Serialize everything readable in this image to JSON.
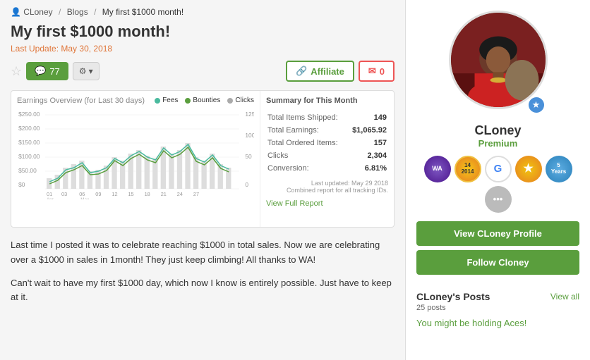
{
  "breadcrumb": {
    "user": "CLoney",
    "section": "Blogs",
    "current": "My first $1000 month!"
  },
  "post": {
    "title": "My first $1000 month!",
    "last_update_label": "Last Update:",
    "date": "May 30, 2018",
    "comment_count": "77",
    "paragraph1": "Last time I posted it was to celebrate reaching $1000 in total sales. Now we are celebrating over a $1000 in sales in 1month! They just keep climbing! All thanks to WA!",
    "paragraph2": "Can't wait to have my first $1000 day, which now I know is entirely possible. Just have to keep at it."
  },
  "toolbar": {
    "affiliate_label": "Affiliate",
    "mail_count": "0",
    "settings_icon": "⚙",
    "dropdown_icon": "▾",
    "star_icon": "☆",
    "comment_icon": "💬",
    "link_icon": "🔗",
    "mail_icon": "✉"
  },
  "chart": {
    "title": "Earnings Overview",
    "subtitle": "(for Last 30 days)",
    "legend": [
      {
        "label": "Fees",
        "color": "#4aba9e"
      },
      {
        "label": "Bounties",
        "color": "#5a9e3d"
      },
      {
        "label": "Clicks",
        "color": "#aaa"
      }
    ],
    "summary_title": "Summary for This Month",
    "rows": [
      {
        "label": "Total Items Shipped:",
        "value": "149"
      },
      {
        "label": "Total Earnings:",
        "value": "$1,065.92"
      },
      {
        "label": "Total Ordered Items:",
        "value": "157"
      },
      {
        "label": "Clicks",
        "value": "2,304"
      },
      {
        "label": "Conversion:",
        "value": "6.81%"
      }
    ],
    "footer1": "Last updated: May 29 2018",
    "footer2": "Combined report for all tracking IDs.",
    "view_report_label": "View Full Report"
  },
  "sidebar": {
    "profile_name": "CLoney",
    "profile_rank": "Premium",
    "star_icon": "★",
    "badges": [
      {
        "label": "WA",
        "type": "purple"
      },
      {
        "label": "14 2014",
        "type": "yellow"
      },
      {
        "label": "G",
        "type": "google"
      },
      {
        "label": "★",
        "type": "star"
      },
      {
        "label": "5 Years",
        "type": "5yr"
      },
      {
        "label": "•••",
        "type": "more"
      }
    ],
    "view_profile_btn": "View CLoney Profile",
    "follow_btn": "Follow Cloney",
    "posts_title": "CLoney's Posts",
    "view_all": "View all",
    "posts_count": "25 posts",
    "featured_post": "You might be holding Aces!"
  }
}
